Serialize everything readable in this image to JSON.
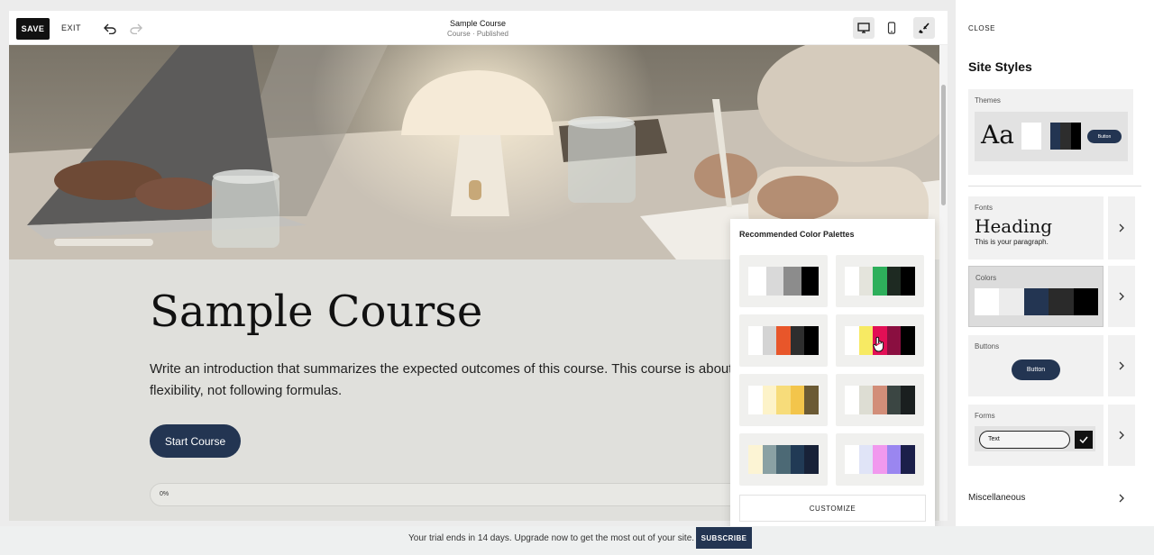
{
  "toolbar": {
    "save_label": "SAVE",
    "exit_label": "EXIT",
    "page_title": "Sample Course",
    "page_subtitle": "Course · Published",
    "icons": [
      "undo-icon",
      "redo-icon",
      "desktop-icon",
      "mobile-icon",
      "paintbrush-icon"
    ]
  },
  "page": {
    "title": "Sample Course",
    "intro": "Write an introduction that summarizes the expected outcomes of this course. This course is about flexibility, not following formulas.",
    "start_button": "Start Course",
    "progress_label": "0%"
  },
  "palette_popover": {
    "title": "Recommended Color Palettes",
    "customize_label": "CUSTOMIZE",
    "palettes": [
      [
        "#ffffff",
        "#d9d9d9",
        "#8c8c8c",
        "#000000"
      ],
      [
        "#ffffff",
        "#e4e4dc",
        "#2eaf5b",
        "#1e2a22",
        "#000000"
      ],
      [
        "#ffffff",
        "#d4d4d4",
        "#e8562a",
        "#2e2e2e",
        "#000000"
      ],
      [
        "#ffffff",
        "#f7ea63",
        "#e20f55",
        "#8a0f40",
        "#000000"
      ],
      [
        "#ffffff",
        "#fdf3c9",
        "#f7dc7a",
        "#f3c54b",
        "#6b5a34"
      ],
      [
        "#ffffff",
        "#ddddd3",
        "#d28e79",
        "#3b4643",
        "#1a1f1f"
      ],
      [
        "#fcf4d4",
        "#8aa1a4",
        "#4c6975",
        "#213a55",
        "#182238"
      ],
      [
        "#ffffff",
        "#e0e4f7",
        "#f199ee",
        "#9a86f0",
        "#1b1f4a"
      ]
    ]
  },
  "trial": {
    "text": "Your trial ends in 14 days. Upgrade now to get the most out of your site.",
    "subscribe_label": "SUBSCRIBE"
  },
  "site_styles": {
    "close_label": "CLOSE",
    "title": "Site Styles",
    "themes": {
      "label": "Themes",
      "sample_text": "Aa",
      "button_text": "Button"
    },
    "fonts": {
      "label": "Fonts",
      "heading": "Heading",
      "paragraph": "This is your paragraph."
    },
    "colors": {
      "label": "Colors",
      "swatches": [
        "#ffffff",
        "#ececec",
        "#233552",
        "#2a2a2a",
        "#000000"
      ]
    },
    "buttons": {
      "label": "Buttons",
      "button_text": "Button"
    },
    "forms": {
      "label": "Forms",
      "field_text": "Text"
    },
    "misc": {
      "label": "Miscellaneous"
    }
  }
}
